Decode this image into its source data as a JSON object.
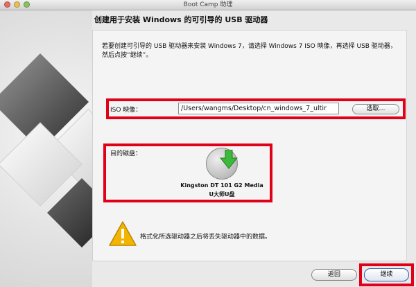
{
  "window": {
    "title": "Boot Camp 助理"
  },
  "heading": "创建用于安装 Windows 的可引导的 USB 驱动器",
  "instructions": "若要创建可引导的 USB 驱动器来安装 Windows 7，请选择 Windows 7 ISO 映像，再选择 USB 驱动器，然后点按“继续”。",
  "iso": {
    "label": "ISO 映像：",
    "value": "/Users/wangms/Desktop/cn_windows_7_ultir",
    "choose_label": "选取…"
  },
  "destination": {
    "label": "目的磁盘：",
    "disk_name": "Kingston DT 101 G2 Media",
    "disk_subtitle": "U大师U盘"
  },
  "warning": {
    "text": "格式化所选驱动器之后将丢失驱动器中的数据。"
  },
  "buttons": {
    "back_label": "返回",
    "continue_label": "继续"
  },
  "colors": {
    "highlight": "#e0001a",
    "disk_arrow": "#3cb83a",
    "warning": "#f2b400"
  },
  "icons": {
    "disk": "external-disk-icon",
    "warning": "warning-icon",
    "art": "windows-logo-art"
  }
}
